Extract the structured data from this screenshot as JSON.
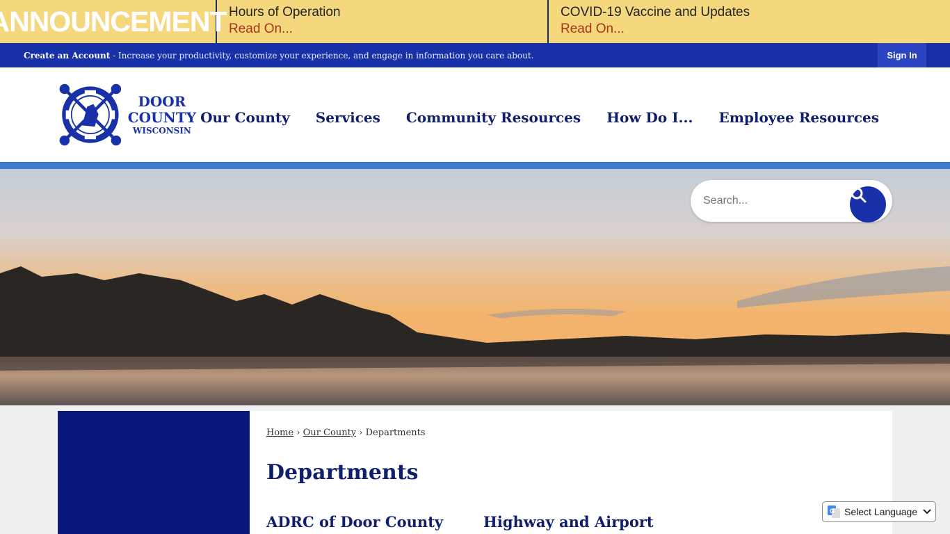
{
  "announcement": {
    "title": "ANNOUNCEMENT",
    "items": [
      {
        "title": "Hours of Operation",
        "link": "Read On..."
      },
      {
        "title": "COVID-19 Vaccine and Updates",
        "link": "Read On..."
      }
    ]
  },
  "account_bar": {
    "create_account": "Create an Account",
    "tagline": " - Increase your productivity, customize your experience, and engage in information you care about.",
    "sign_in": "Sign In"
  },
  "logo": {
    "line1": "DOOR",
    "line2": "COUNTY",
    "line3": "WISCONSIN"
  },
  "nav": {
    "items": [
      "Our County",
      "Services",
      "Community Resources",
      "How Do I...",
      "Employee Resources"
    ]
  },
  "search": {
    "placeholder": "Search..."
  },
  "breadcrumb": {
    "home": "Home",
    "our_county": "Our County",
    "current": "Departments"
  },
  "page": {
    "title": "Departments",
    "departments": [
      "ADRC of Door County",
      "Highway and Airport"
    ]
  },
  "translate": {
    "label": "Select Language"
  },
  "colors": {
    "announce_bg": "#f5d77e",
    "account_bar": "#1931a8",
    "nav_text": "#0f1f6b",
    "accent_blue": "#3d7bd0",
    "sidebar": "#0a177d",
    "read_on": "#a83317"
  }
}
